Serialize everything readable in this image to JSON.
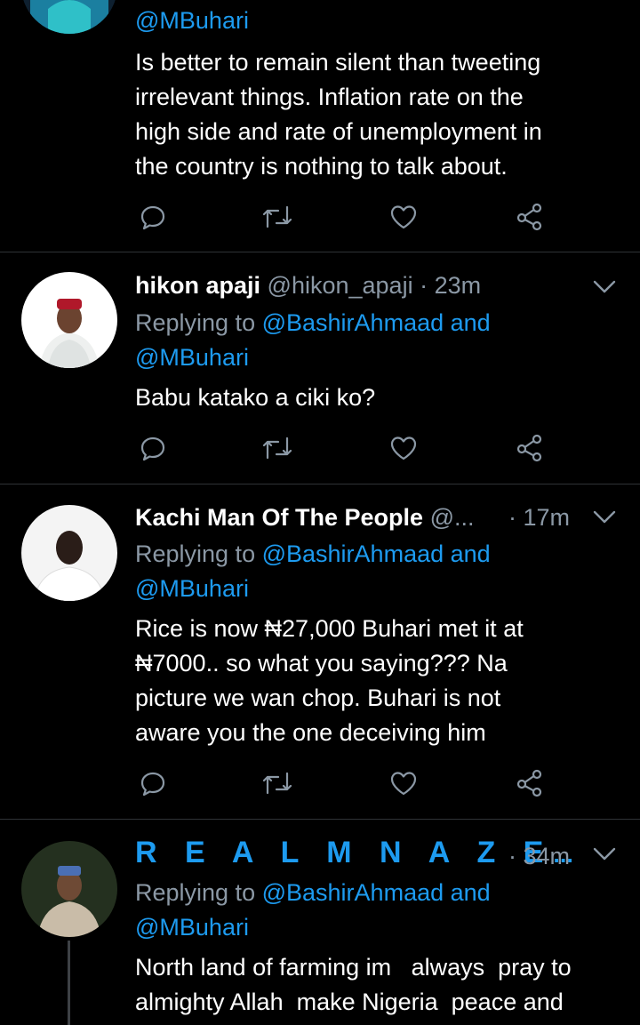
{
  "tweets": [
    {
      "reply_tail": "@MBuhari",
      "lines": [
        "Is better to remain silent than tweeting",
        "irrelevant things. Inflation rate on the",
        "high side and rate of unemployment in",
        "the country is nothing to talk about."
      ]
    },
    {
      "name": "hikon apaji",
      "handle": "@hikon_apaji",
      "time": "· 23m",
      "replying_prefix": "Replying to",
      "replying_to": "@BashirAhmaad and",
      "replying_to2": "@MBuhari",
      "lines": [
        "Babu katako a ciki ko?"
      ]
    },
    {
      "name": "Kachi Man Of The People",
      "handle": "@...",
      "time": "· 17m",
      "replying_prefix": "Replying to",
      "replying_to": "@BashirAhmaad and",
      "replying_to2": "@MBuhari",
      "lines": [
        "Rice is now ₦27,000 Buhari met it at",
        "₦7000.. so what you saying??? Na",
        "picture we wan chop. Buhari is not",
        "aware you the one deceiving him"
      ]
    },
    {
      "name": "R E A L M N A Z E",
      "ellipsis": "...",
      "time": "· 34m",
      "replying_prefix": "Replying to",
      "replying_to": "@BashirAhmaad and",
      "replying_to2": "@MBuhari",
      "lines": [
        "North land of farming im   always  pray to",
        "almighty Allah  make Nigeria  peace and"
      ]
    }
  ],
  "icons": [
    "reply-icon",
    "retweet-icon",
    "like-icon",
    "share-icon",
    "chevron-down-icon"
  ],
  "colors": {
    "background": "#000000",
    "accent": "#1d9bf0",
    "muted": "#8b98a5",
    "divider": "#2f3336"
  }
}
